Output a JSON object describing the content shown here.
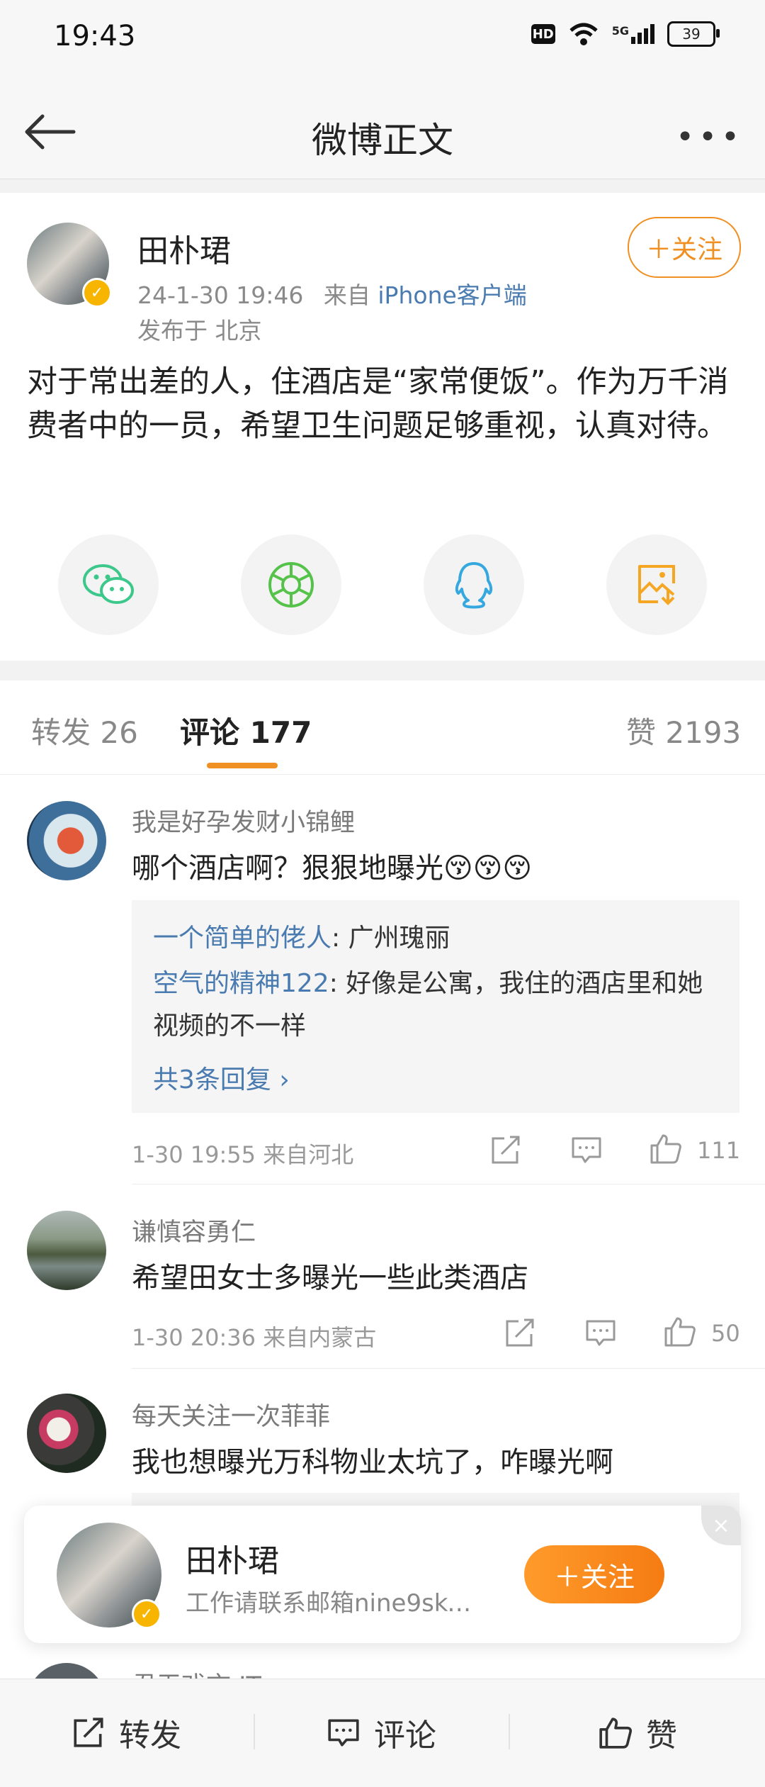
{
  "status": {
    "time": "19:43",
    "hd": "HD",
    "signal": "5G",
    "battery": "39"
  },
  "nav": {
    "title": "微博正文"
  },
  "post": {
    "author": "田朴珺",
    "time": "24-1-30 19:46",
    "from_prefix": "来自",
    "source": "iPhone客户端",
    "location": "发布于 北京",
    "follow_label": "＋关注",
    "text": "对于常出差的人，住酒店是“家常便饭”。作为万千消费者中的一员，希望卫生问题足够重视，认真对待。",
    "share_icons": [
      "wechat-icon",
      "moments-icon",
      "qq-icon",
      "save-image-icon"
    ]
  },
  "tabs": {
    "repost": "转发 26",
    "comments": "评论 177",
    "likes": "赞 2193"
  },
  "comments": [
    {
      "name": "我是好孕发财小锦鲤",
      "text": "哪个酒店啊？狠狠地曝光😚😚😚",
      "replies": [
        {
          "name": "一个简单的佬人",
          "text": ": 广州瑰丽"
        },
        {
          "name": "空气的精神122",
          "text": ": 好像是公寓，我住的酒店里和她视频的不一样"
        }
      ],
      "more_replies": "共3条回复 ›",
      "meta": "1-30 19:55  来自河北",
      "likes": "111"
    },
    {
      "name": "谦慎容勇仁",
      "text": "希望田女士多曝光一些此类酒店",
      "meta": "1-30 20:36  来自内蒙古",
      "likes": "50"
    },
    {
      "name": "每天关注一次菲菲",
      "text": "我也想曝光万科物业太坑了，咋曝光啊"
    },
    {
      "name": "君无戏言 IT"
    }
  ],
  "float_card": {
    "name": "田朴珺",
    "desc": "工作请联系邮箱nine9sky…",
    "follow_label": "＋关注",
    "close": "×"
  },
  "bottom": {
    "repost": "转发",
    "comment": "评论",
    "like": "赞"
  },
  "colors": {
    "accent": "#f08f22",
    "link": "#4a7bb0"
  }
}
